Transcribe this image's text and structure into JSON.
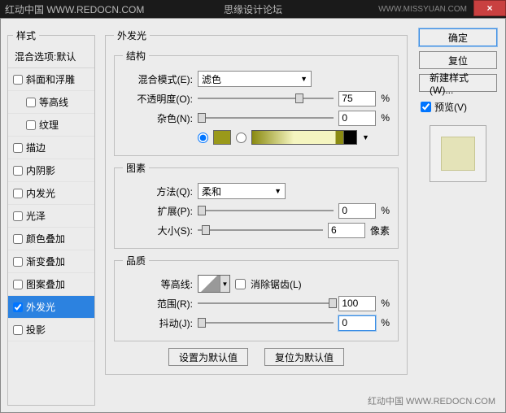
{
  "titlebar": {
    "left": "红动中国  WWW.REDOCN.COM",
    "mid": "思缘设计论坛",
    "right": "WWW.MISSYUAN.COM",
    "close": "×"
  },
  "sidebar": {
    "legend": "样式",
    "header": "混合选项:默认",
    "items": [
      {
        "label": "斜面和浮雕",
        "checked": false
      },
      {
        "label": "等高线",
        "checked": false,
        "indent": true
      },
      {
        "label": "纹理",
        "checked": false,
        "indent": true
      },
      {
        "label": "描边",
        "checked": false
      },
      {
        "label": "内阴影",
        "checked": false
      },
      {
        "label": "内发光",
        "checked": false
      },
      {
        "label": "光泽",
        "checked": false
      },
      {
        "label": "颜色叠加",
        "checked": false
      },
      {
        "label": "渐变叠加",
        "checked": false
      },
      {
        "label": "图案叠加",
        "checked": false
      },
      {
        "label": "外发光",
        "checked": true,
        "selected": true
      },
      {
        "label": "投影",
        "checked": false
      }
    ]
  },
  "main": {
    "title": "外发光",
    "struct": {
      "legend": "结构",
      "blend_label": "混合模式(E):",
      "blend_value": "滤色",
      "opacity_label": "不透明度(O):",
      "opacity_value": "75",
      "opacity_unit": "%",
      "noise_label": "杂色(N):",
      "noise_value": "0",
      "noise_unit": "%",
      "color_hex": "#9a991a"
    },
    "elem": {
      "legend": "图素",
      "method_label": "方法(Q):",
      "method_value": "柔和",
      "spread_label": "扩展(P):",
      "spread_value": "0",
      "spread_unit": "%",
      "size_label": "大小(S):",
      "size_value": "6",
      "size_unit": "像素"
    },
    "qual": {
      "legend": "品质",
      "contour_label": "等高线:",
      "aa_label": "消除锯齿(L)",
      "range_label": "范围(R):",
      "range_value": "100",
      "range_unit": "%",
      "jitter_label": "抖动(J):",
      "jitter_value": "0",
      "jitter_unit": "%"
    },
    "buttons": {
      "default": "设置为默认值",
      "reset": "复位为默认值"
    }
  },
  "right": {
    "ok": "确定",
    "cancel": "复位",
    "newstyle": "新建样式(W)...",
    "preview_label": "预览(V)"
  },
  "footer": "红动中国  WWW.REDOCN.COM"
}
